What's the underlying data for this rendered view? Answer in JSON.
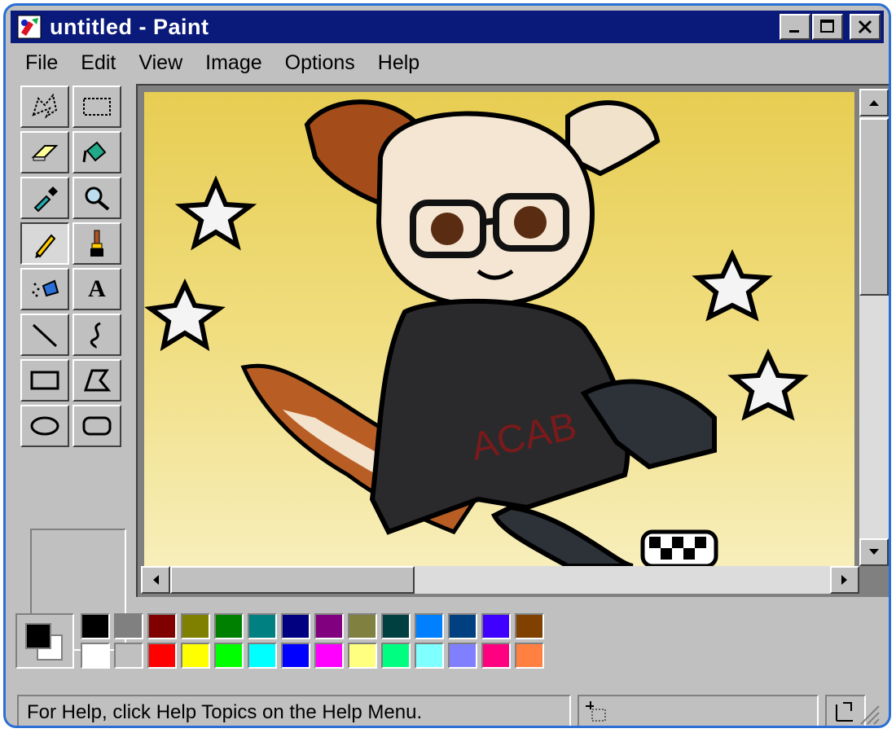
{
  "window": {
    "title": "untitled - Paint",
    "border_color": "#2a6fd6",
    "titlebar_color": "#0a1a7a"
  },
  "menu": [
    "File",
    "Edit",
    "View",
    "Image",
    "Options",
    "Help"
  ],
  "tools": [
    {
      "name": "free-form-select"
    },
    {
      "name": "select"
    },
    {
      "name": "eraser"
    },
    {
      "name": "fill"
    },
    {
      "name": "pick-color"
    },
    {
      "name": "magnifier"
    },
    {
      "name": "pencil",
      "active": true
    },
    {
      "name": "brush"
    },
    {
      "name": "airbrush"
    },
    {
      "name": "text",
      "glyph": "A"
    },
    {
      "name": "line"
    },
    {
      "name": "curve"
    },
    {
      "name": "rectangle"
    },
    {
      "name": "polygon"
    },
    {
      "name": "ellipse"
    },
    {
      "name": "rounded-rectangle"
    }
  ],
  "palette": {
    "foreground": "#000000",
    "background": "#ffffff",
    "top_row": [
      "#000000",
      "#808080",
      "#800000",
      "#808000",
      "#008000",
      "#008080",
      "#000080",
      "#800080",
      "#808040",
      "#004040",
      "#0080ff",
      "#004080",
      "#4000ff",
      "#804000"
    ],
    "bottom_row": [
      "#ffffff",
      "#c0c0c0",
      "#ff0000",
      "#ffff00",
      "#00ff00",
      "#00ffff",
      "#0000ff",
      "#ff00ff",
      "#ffff80",
      "#00ff80",
      "#80ffff",
      "#8080ff",
      "#ff0080",
      "#ff8040"
    ]
  },
  "canvas": {
    "hoodie_text": "ACAB",
    "background_top": "#e7cd52",
    "background_bottom": "#f7eebb"
  },
  "status": {
    "help_text": "For Help, click Help Topics on the Help Menu."
  }
}
